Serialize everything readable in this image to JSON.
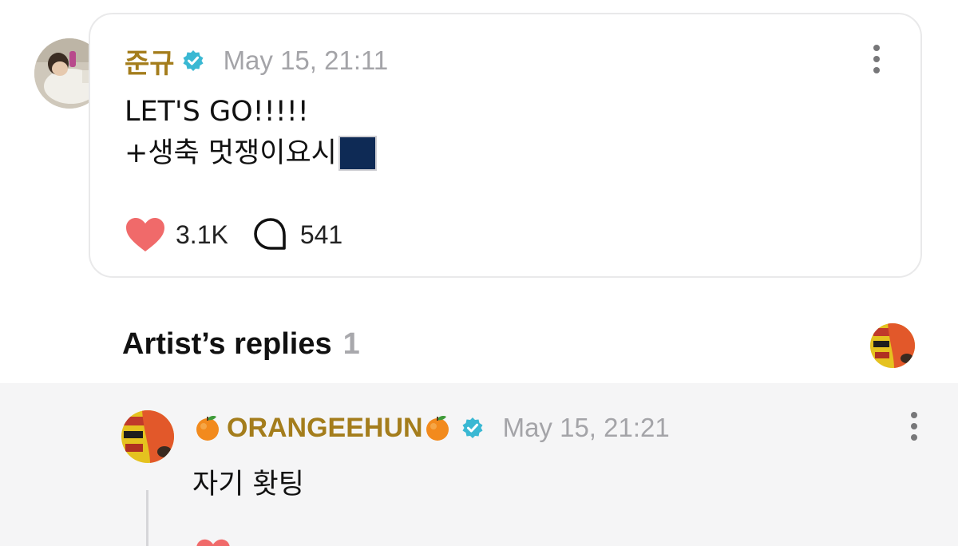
{
  "post": {
    "author": "준규",
    "timestamp": "May 15, 21:11",
    "text_line1": "LET'S GO!!!!!",
    "text_line2": "+생축 멋쟁이요시",
    "sticker": "star-sticker",
    "likes": "3.1K",
    "comments": "541"
  },
  "replies_section": {
    "title": "Artist’s replies",
    "count": "1"
  },
  "reply": {
    "author": "ORANGEEHUN",
    "timestamp": "May 15, 21:21",
    "text": "자기 홧팅"
  },
  "colors": {
    "author_name": "#a47d1c",
    "verified_badge": "#3ab8d3",
    "heart": "#f06a6a",
    "timestamp": "#a4a4a8",
    "reply_background": "#f5f5f6"
  }
}
